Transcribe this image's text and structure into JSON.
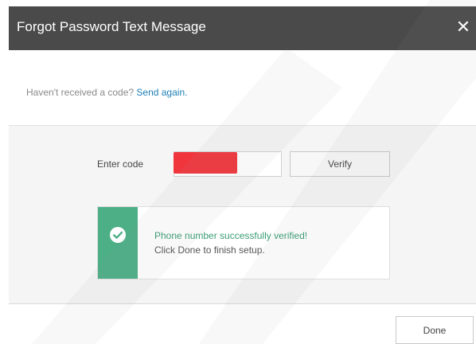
{
  "window": {
    "title": "Forgot Password Text Message",
    "close_glyph": "✕"
  },
  "resend": {
    "prompt": "Haven't received a code?",
    "link": "Send again."
  },
  "code": {
    "label": "Enter code",
    "value": "",
    "placeholder": "",
    "verify_label": "Verify"
  },
  "success": {
    "icon": "check-circle-icon",
    "title": "Phone number successfully verified!",
    "subtitle": "Click Done to finish setup."
  },
  "footer": {
    "done_label": "Done"
  },
  "colors": {
    "titlebar": "#4a4a4a",
    "accent_green": "#4caf86",
    "link_blue": "#1f7fb5",
    "redaction": "#f0353d"
  }
}
